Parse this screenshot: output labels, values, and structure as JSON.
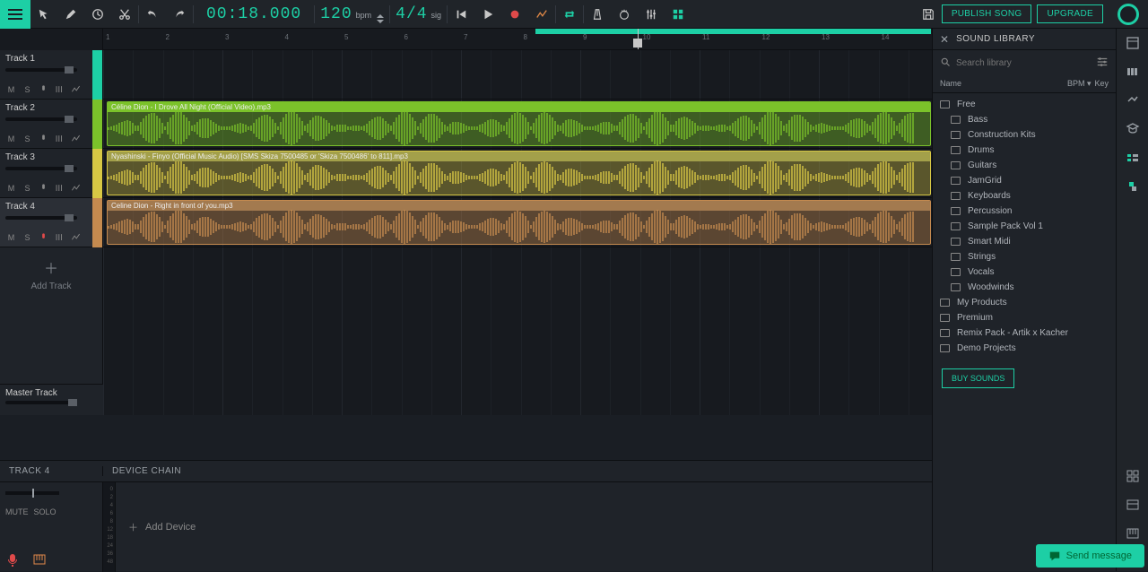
{
  "topbar": {
    "time": "00:18.000",
    "bpm_value": "120",
    "bpm_label": "bpm",
    "sig_value": "4/4",
    "sig_label": "sig",
    "publish": "PUBLISH SONG",
    "upgrade": "UPGRADE"
  },
  "tracks": [
    {
      "name": "Track 1",
      "color": "#1dcfa5",
      "slider": 82
    },
    {
      "name": "Track 2",
      "color": "#7bc22a",
      "slider": 82,
      "clip": {
        "label": "Céline Dion - I Drove All Night (Official Video).mp3",
        "start": 4,
        "end": 923,
        "color": "rgba(123,194,42,0.4)",
        "labelbg": "#7bc22a"
      }
    },
    {
      "name": "Track 3",
      "color": "#d7c844",
      "slider": 82,
      "clip": {
        "label": "Nyashinski - Finyo (Official Music Audio) [SMS Skiza 7500485 or 'Skiza 7500486' to 811].mp3",
        "start": 4,
        "end": 923,
        "color": "rgba(215,200,68,0.35)",
        "labelbg": "#a3a04a"
      }
    },
    {
      "name": "Track 4",
      "color": "#c48a4f",
      "slider": 82,
      "sel": true,
      "clip": {
        "label": "Celine Dion - Right in front of you.mp3",
        "start": 4,
        "end": 923,
        "color": "rgba(196,138,79,0.4)",
        "labelbg": "#a37a4f"
      }
    }
  ],
  "add_track": "Add Track",
  "master": "Master Track",
  "ruler_start": 1,
  "ruler_end": 15,
  "loop": {
    "start": 482,
    "end": 923
  },
  "playhead": 596,
  "track_btns": {
    "m": "M",
    "s": "S"
  },
  "footer": {
    "track": "TRACK 4",
    "device_chain": "DEVICE CHAIN",
    "mute": "MUTE",
    "solo": "SOLO",
    "add_device": "Add Device",
    "meter_ticks": [
      "0",
      "2",
      "4",
      "6",
      "8",
      "12",
      "18",
      "24",
      "36",
      "48"
    ]
  },
  "library": {
    "title": "SOUND LIBRARY",
    "search_ph": "Search library",
    "col_name": "Name",
    "col_bpm": "BPM",
    "col_key": "Key",
    "items": [
      {
        "label": "Free",
        "sub": false
      },
      {
        "label": "Bass",
        "sub": true
      },
      {
        "label": "Construction Kits",
        "sub": true
      },
      {
        "label": "Drums",
        "sub": true
      },
      {
        "label": "Guitars",
        "sub": true
      },
      {
        "label": "JamGrid",
        "sub": true
      },
      {
        "label": "Keyboards",
        "sub": true
      },
      {
        "label": "Percussion",
        "sub": true
      },
      {
        "label": "Sample Pack Vol 1",
        "sub": true
      },
      {
        "label": "Smart Midi",
        "sub": true
      },
      {
        "label": "Strings",
        "sub": true
      },
      {
        "label": "Vocals",
        "sub": true
      },
      {
        "label": "Woodwinds",
        "sub": true
      },
      {
        "label": "My Products",
        "sub": false
      },
      {
        "label": "Premium",
        "sub": false
      },
      {
        "label": "Remix Pack - Artik x Kacher",
        "sub": false
      },
      {
        "label": "Demo Projects",
        "sub": false
      }
    ],
    "buy": "BUY SOUNDS"
  },
  "chat": "Send message"
}
